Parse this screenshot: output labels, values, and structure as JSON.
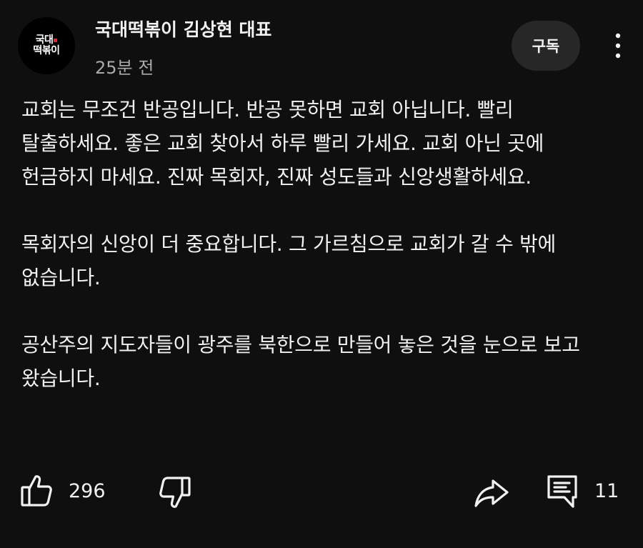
{
  "header": {
    "avatar_line1": "국대",
    "avatar_line2": "떡볶이",
    "channel_name": "국대떡볶이 김상현 대표",
    "timestamp": "25분 전",
    "subscribe_label": "구독",
    "more_icon": "more-vertical-icon"
  },
  "post": {
    "paragraphs": [
      "교회는 무조건 반공입니다. 반공 못하면 교회 아닙니다. 빨리 탈출하세요. 좋은 교회 찾아서 하루 빨리 가세요. 교회 아닌 곳에 헌금하지 마세요. 진짜 목회자, 진짜 성도들과 신앙생활하세요.",
      "목회자의 신앙이 더 중요합니다. 그 가르침으로 교회가 갈 수 밖에 없습니다.",
      "공산주의 지도자들이 광주를 북한으로 만들어 놓은 것을 눈으로 보고 왔습니다."
    ]
  },
  "actions": {
    "like_icon": "thumbs-up-icon",
    "like_count": "296",
    "dislike_icon": "thumbs-down-icon",
    "share_icon": "share-icon",
    "comment_icon": "comment-icon",
    "comment_count": "11"
  },
  "colors": {
    "background": "#0f0f0f",
    "text": "#f1f1f1",
    "secondary_text": "#aaaaaa",
    "button_bg": "#272727",
    "avatar_accent": "#e0283a"
  }
}
